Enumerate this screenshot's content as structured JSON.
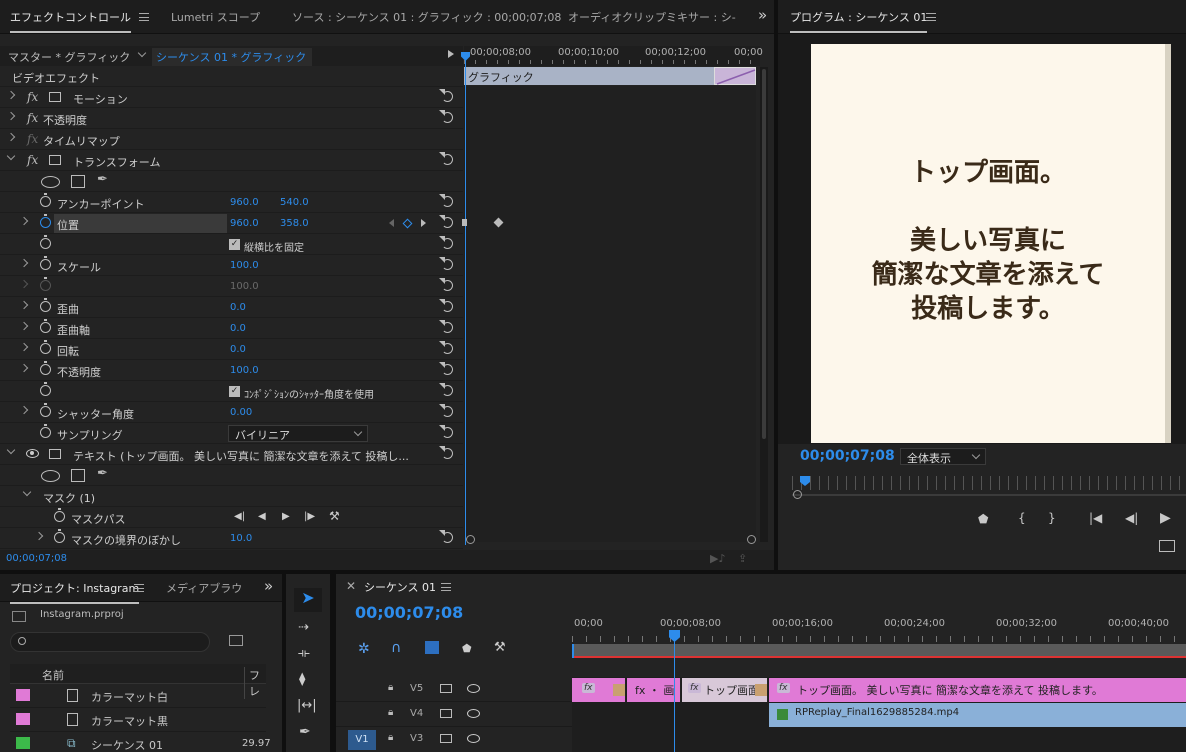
{
  "effect_controls": {
    "tabs": [
      {
        "label": "エフェクトコントロール",
        "active": true
      },
      {
        "label": "Lumetri スコープ",
        "active": false
      },
      {
        "label": "ソース : シーケンス 01 : グラフィック : 00;00;07;08",
        "active": false
      },
      {
        "label": "オーディオクリップミキサー : シ-",
        "active": false
      }
    ],
    "overflow_icon": "»",
    "master_label": "マスター * グラフィック",
    "sequence_label": "シーケンス 01 * グラフィック",
    "timeline_times": [
      "00;00;08;00",
      "00;00;10;00",
      "00;00;12;00",
      "00;00"
    ],
    "clip_label": "グラフィック",
    "section_label": "ビデオエフェクト",
    "rows": {
      "motion": "モーション",
      "opacity": "不透明度",
      "time_remap": "タイムリマップ",
      "transform": "トランスフォーム",
      "anchor": {
        "label": "アンカーポイント",
        "x": "960.0",
        "y": "540.0"
      },
      "position": {
        "label": "位置",
        "x": "960.0",
        "y": "358.0"
      },
      "uniform_scale": "縦横比を固定",
      "scale": {
        "label": "スケール",
        "value": "100.0"
      },
      "scale_width": "100.0",
      "skew": {
        "label": "歪曲",
        "value": "0.0"
      },
      "skew_axis": {
        "label": "歪曲軸",
        "value": "0.0"
      },
      "rotation": {
        "label": "回転",
        "value": "0.0"
      },
      "opacity2": {
        "label": "不透明度",
        "value": "100.0"
      },
      "comp_shutter": "ｺﾝﾎﾟｼﾞｼｮﾝのｼｬｯﾀｰ角度を使用",
      "shutter_angle": {
        "label": "シャッター角度",
        "value": "0.00"
      },
      "sampling": {
        "label": "サンプリング",
        "value": "バイリニア"
      },
      "text": "テキスト (トップ画面。 美しい写真に 簡潔な文章を添えて 投稿し...",
      "mask": "マスク (1)",
      "mask_path": "マスクパス",
      "mask_feather": {
        "label": "マスクの境界のぼかし",
        "value": "10.0"
      }
    },
    "current_time": "00;00;07;08"
  },
  "program_monitor": {
    "title": "プログラム : シーケンス 01",
    "frame_text": [
      "トップ画面。",
      "",
      "美しい写真に",
      "簡潔な文章を添えて",
      "投稿します。"
    ],
    "timecode": "00;00;07;08",
    "zoom": "全体表示",
    "frame_bg": "#fdf7eb",
    "frame_text_color": "#3a2a18"
  },
  "project": {
    "tabs": [
      {
        "label": "プロジェクト: Instagram",
        "active": true
      },
      {
        "label": "メディアブラウ",
        "active": false
      }
    ],
    "file": "Instagram.prproj",
    "columns": [
      "名前",
      "フレ"
    ],
    "items": [
      {
        "name": "カラーマット白",
        "color": "#e07ad6",
        "rate": ""
      },
      {
        "name": "カラーマット黒",
        "color": "#e07ad6",
        "rate": ""
      },
      {
        "name": "シーケンス 01",
        "color": "#3cb94a",
        "rate": "29.97"
      }
    ]
  },
  "timeline": {
    "title": "シーケンス 01",
    "timecode": "00;00;07;08",
    "ruler": [
      "00;00",
      "00;00;08;00",
      "00;00;16;00",
      "00;00;24;00",
      "00;00;32;00",
      "00;00;40;00"
    ],
    "tracks": [
      {
        "name": "V5",
        "target": ""
      },
      {
        "name": "V4",
        "target": ""
      },
      {
        "name": "V3",
        "target": "V1"
      }
    ],
    "clips": {
      "v5_a": "fx",
      "v5_b": "fx ・ 画",
      "v5_c": "トップ画面",
      "v5_d": "トップ画面。 美しい写真に 簡潔な文章を添えて 投稿します。",
      "v4": "RPReplay_Final1629885284.mp4"
    }
  }
}
